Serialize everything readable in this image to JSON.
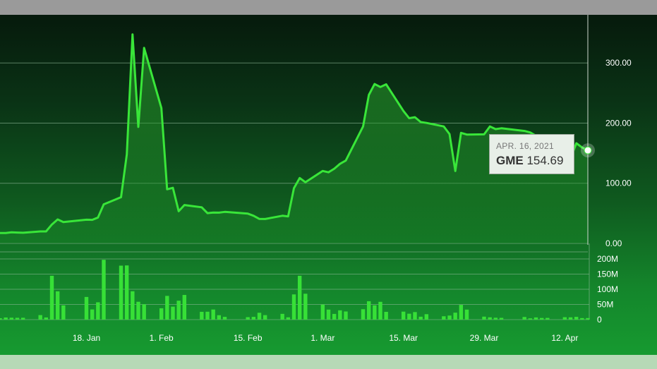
{
  "tooltip": {
    "date": "APR. 16, 2021",
    "ticker": "GME",
    "value": "154.69"
  },
  "colors": {
    "line": "#39e639",
    "bar": "#37e037",
    "grid": "#8fb99a",
    "label": "#ffffff"
  },
  "chart_data": [
    {
      "type": "area",
      "series": [
        {
          "name": "GME",
          "x": [
            "2021-01-04",
            "2021-01-05",
            "2021-01-06",
            "2021-01-07",
            "2021-01-08",
            "2021-01-11",
            "2021-01-12",
            "2021-01-13",
            "2021-01-14",
            "2021-01-15",
            "2021-01-19",
            "2021-01-20",
            "2021-01-21",
            "2021-01-22",
            "2021-01-25",
            "2021-01-26",
            "2021-01-27",
            "2021-01-28",
            "2021-01-29",
            "2021-02-01",
            "2021-02-02",
            "2021-02-03",
            "2021-02-04",
            "2021-02-05",
            "2021-02-08",
            "2021-02-09",
            "2021-02-10",
            "2021-02-11",
            "2021-02-12",
            "2021-02-16",
            "2021-02-17",
            "2021-02-18",
            "2021-02-19",
            "2021-02-22",
            "2021-02-23",
            "2021-02-24",
            "2021-02-25",
            "2021-02-26",
            "2021-03-01",
            "2021-03-02",
            "2021-03-03",
            "2021-03-04",
            "2021-03-05",
            "2021-03-08",
            "2021-03-09",
            "2021-03-10",
            "2021-03-11",
            "2021-03-12",
            "2021-03-15",
            "2021-03-16",
            "2021-03-17",
            "2021-03-18",
            "2021-03-19",
            "2021-03-22",
            "2021-03-23",
            "2021-03-24",
            "2021-03-25",
            "2021-03-26",
            "2021-03-29",
            "2021-03-30",
            "2021-03-31",
            "2021-04-01",
            "2021-04-05",
            "2021-04-06",
            "2021-04-07",
            "2021-04-08",
            "2021-04-09",
            "2021-04-12",
            "2021-04-13",
            "2021-04-14",
            "2021-04-15",
            "2021-04-16"
          ],
          "values": [
            17.25,
            17.37,
            18.36,
            18.08,
            17.69,
            19.94,
            19.95,
            31.4,
            39.91,
            35.5,
            39.36,
            39.12,
            43.03,
            65.01,
            76.79,
            147.98,
            347.51,
            193.6,
            325.0,
            225.0,
            90.0,
            92.41,
            53.5,
            63.77,
            60.0,
            50.31,
            51.2,
            51.1,
            52.4,
            49.51,
            45.94,
            40.69,
            40.59,
            46.0,
            44.97,
            91.71,
            108.73,
            101.74,
            120.4,
            118.18,
            124.18,
            132.35,
            137.74,
            194.5,
            246.9,
            265.0,
            260.0,
            264.5,
            220.14,
            208.17,
            209.81,
            201.75,
            200.27,
            194.49,
            181.75,
            120.34,
            183.75,
            181.0,
            181.3,
            194.46,
            190.0,
            191.45,
            186.95,
            184.5,
            179.0,
            170.26,
            158.36,
            141.09,
            140.99,
            166.53,
            159.48,
            154.69
          ]
        }
      ],
      "x_tick_labels": [
        "18. Jan",
        "1. Feb",
        "15. Feb",
        "1. Mar",
        "15. Mar",
        "29. Mar",
        "12. Apr"
      ],
      "y_tick_labels": [
        "0.00",
        "100.00",
        "200.00",
        "300.00"
      ],
      "ylim": [
        0,
        380
      ],
      "grid": true
    },
    {
      "type": "bar",
      "series": [
        {
          "name": "Volume",
          "values": [
            4.5,
            7.0,
            6.3,
            6.0,
            6.1,
            14.9,
            7.1,
            144.5,
            93.2,
            46.9,
            74.7,
            33.5,
            57.1,
            197.2,
            177.9,
            178.6,
            93.4,
            58.8,
            50.6,
            37.4,
            78.2,
            42.7,
            62.4,
            81.3,
            25.7,
            26.0,
            33.3,
            14.5,
            9.1,
            8.1,
            9.1,
            22.6,
            14.8,
            19.0,
            7.6,
            83.1,
            144.5,
            85.3,
            49.8,
            33.0,
            18.8,
            30.6,
            26.8,
            34.3,
            60.6,
            47.1,
            58.6,
            25.6,
            26.3,
            19.5,
            24.8,
            9.6,
            17.9,
            11.1,
            13.4,
            22.9,
            48.6,
            33.0,
            9.8,
            7.6,
            6.2,
            5.8,
            8.7,
            4.1,
            7.2,
            5.4,
            5.6,
            8.0,
            7.5,
            9.1,
            5.0,
            5.1
          ]
        }
      ],
      "y_tick_labels": [
        "0",
        "50M",
        "100M",
        "150M",
        "200M"
      ],
      "ylim": [
        0,
        200
      ],
      "grid": true
    }
  ]
}
